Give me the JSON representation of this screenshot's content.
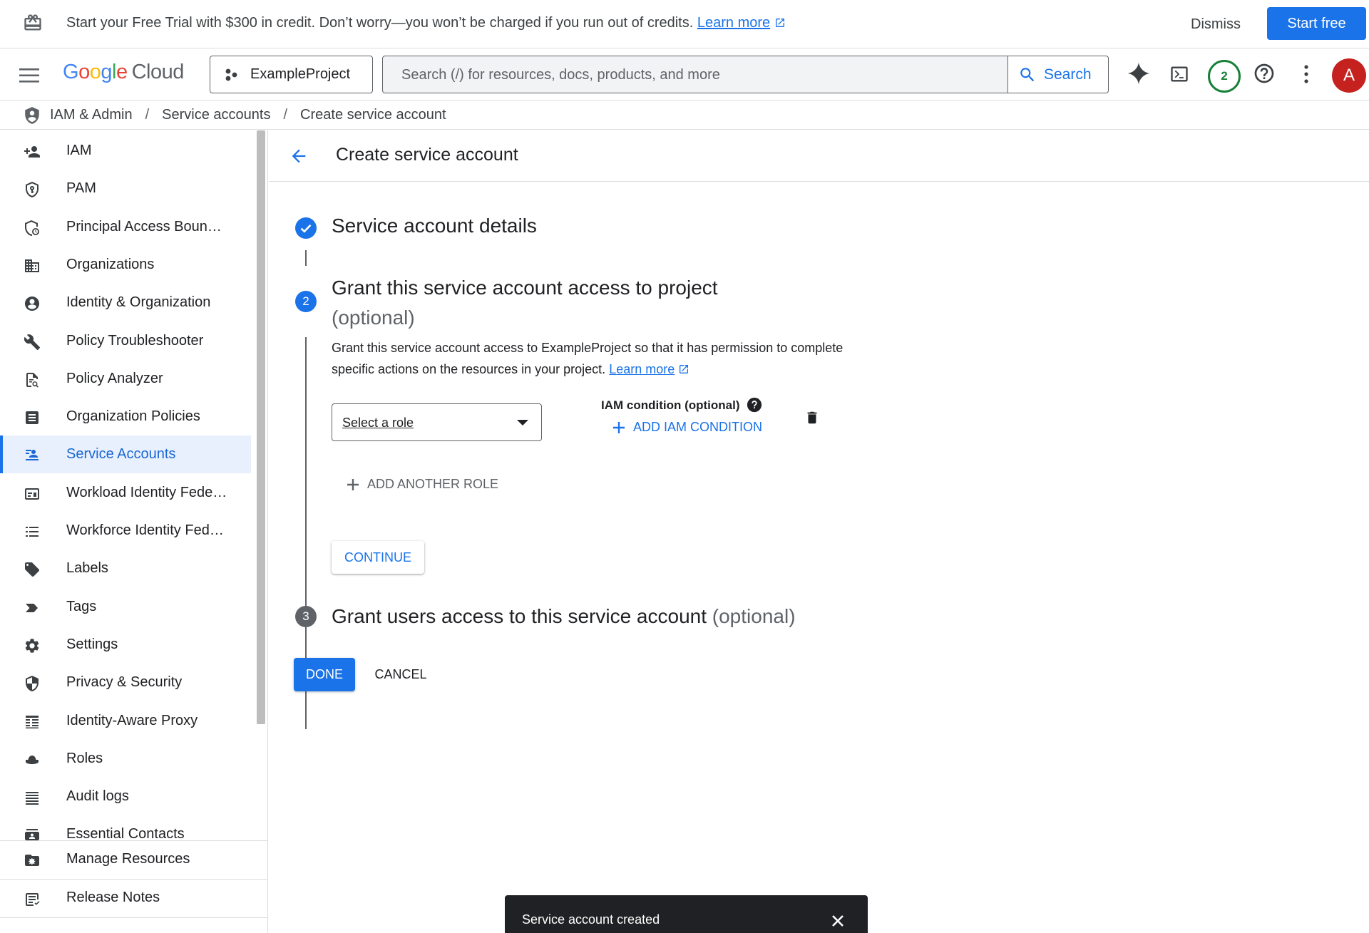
{
  "banner": {
    "message": "Start your Free Trial with $300 in credit. Don’t worry—you won’t be charged if you run out of credits.",
    "learn_more": "Learn more",
    "dismiss": "Dismiss",
    "start_free": "Start free"
  },
  "header": {
    "logo_google": "Google",
    "logo_cloud": "Cloud",
    "project": "ExampleProject",
    "search_placeholder": "Search (/) for resources, docs, products, and more",
    "search_button": "Search",
    "notifications_count": "2",
    "avatar_letter": "A"
  },
  "breadcrumb": {
    "items": [
      "IAM & Admin",
      "Service accounts",
      "Create service account"
    ],
    "separator": "/"
  },
  "sidebar": {
    "items": [
      {
        "label": "IAM",
        "icon": "person-add-icon"
      },
      {
        "label": "PAM",
        "icon": "shield-key-icon"
      },
      {
        "label": "Principal Access Boun…",
        "icon": "shield-clock-icon"
      },
      {
        "label": "Organizations",
        "icon": "building-icon"
      },
      {
        "label": "Identity & Organization",
        "icon": "account-circle-icon"
      },
      {
        "label": "Policy Troubleshooter",
        "icon": "wrench-icon"
      },
      {
        "label": "Policy Analyzer",
        "icon": "document-search-icon"
      },
      {
        "label": "Organization Policies",
        "icon": "list-box-icon"
      },
      {
        "label": "Service Accounts",
        "icon": "service-account-icon",
        "active": true
      },
      {
        "label": "Workload Identity Fede…",
        "icon": "id-card-icon"
      },
      {
        "label": "Workforce Identity Fed…",
        "icon": "list-icon"
      },
      {
        "label": "Labels",
        "icon": "label-icon"
      },
      {
        "label": "Tags",
        "icon": "tag-arrow-icon"
      },
      {
        "label": "Settings",
        "icon": "gear-icon"
      },
      {
        "label": "Privacy & Security",
        "icon": "shield-icon"
      },
      {
        "label": "Identity-Aware Proxy",
        "icon": "proxy-icon"
      },
      {
        "label": "Roles",
        "icon": "hat-icon"
      },
      {
        "label": "Audit logs",
        "icon": "lines-icon"
      },
      {
        "label": "Essential Contacts",
        "icon": "contact-icon"
      }
    ],
    "manage_resources": "Manage Resources",
    "release_notes": "Release Notes"
  },
  "main": {
    "page_title": "Create service account",
    "step1": {
      "title": "Service account details"
    },
    "step2": {
      "number": "2",
      "title": "Grant this service account access to project",
      "optional": "(optional)",
      "description": "Grant this service account access to ExampleProject so that it has permission to complete specific actions on the resources in your project.",
      "learn_more": "Learn more",
      "role_select": "Select a role",
      "iam_condition_label": "IAM condition (optional)",
      "add_iam_condition": "ADD IAM CONDITION",
      "add_another_role": "ADD ANOTHER ROLE",
      "continue": "CONTINUE"
    },
    "step3": {
      "number": "3",
      "title": "Grant users access to this service account",
      "optional": "(optional)"
    },
    "done": "DONE",
    "cancel": "CANCEL"
  },
  "toast": {
    "message": "Service account created"
  },
  "colors": {
    "accent": "#1a73e8",
    "active_bg": "#e8f0fe",
    "notification": "#188038",
    "avatar": "#c5221f"
  }
}
